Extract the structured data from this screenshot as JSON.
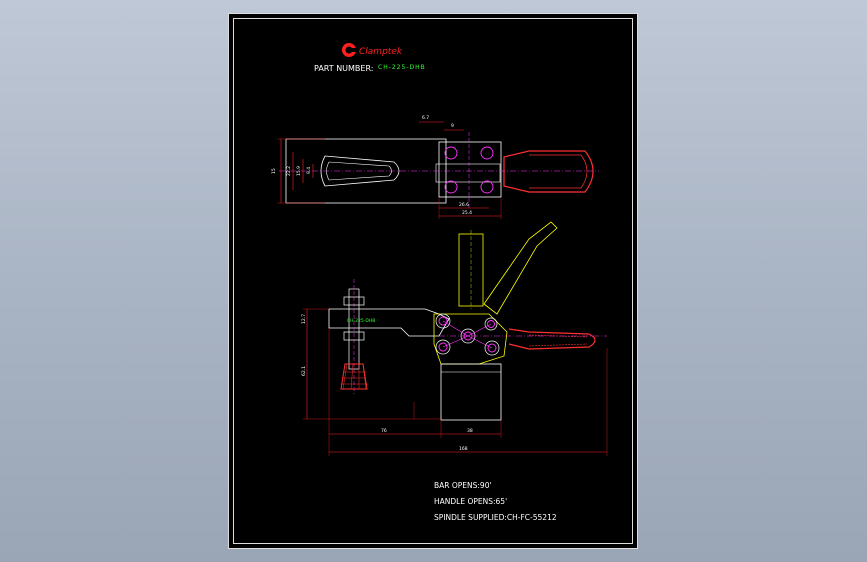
{
  "brand": {
    "logo_text": "Clamptek",
    "logo_color": "#ff2020"
  },
  "part": {
    "label": "PART NUMBER:",
    "number": "CH-225-DHB"
  },
  "dimensions": {
    "top_view": [
      "6.7",
      "9",
      "15",
      "22.2",
      "15.9",
      "9.4",
      "26.6",
      "25.4"
    ],
    "side_view": [
      "12.7",
      "62.1",
      "76",
      "38",
      "168"
    ]
  },
  "callout_label": "CH-225-DHB",
  "notes": [
    "BAR OPENS:90'",
    "HANDLE OPENS:65'",
    "SPINDLE SUPPLIED:CH-FC-55212"
  ],
  "colors": {
    "background": "#000000",
    "outline": "#ffffff",
    "dimension": "#ff2020",
    "centerline": "#ff33ff",
    "highlight": "#ffff00",
    "handle": "#ff3030",
    "label_green": "#33ff33"
  }
}
